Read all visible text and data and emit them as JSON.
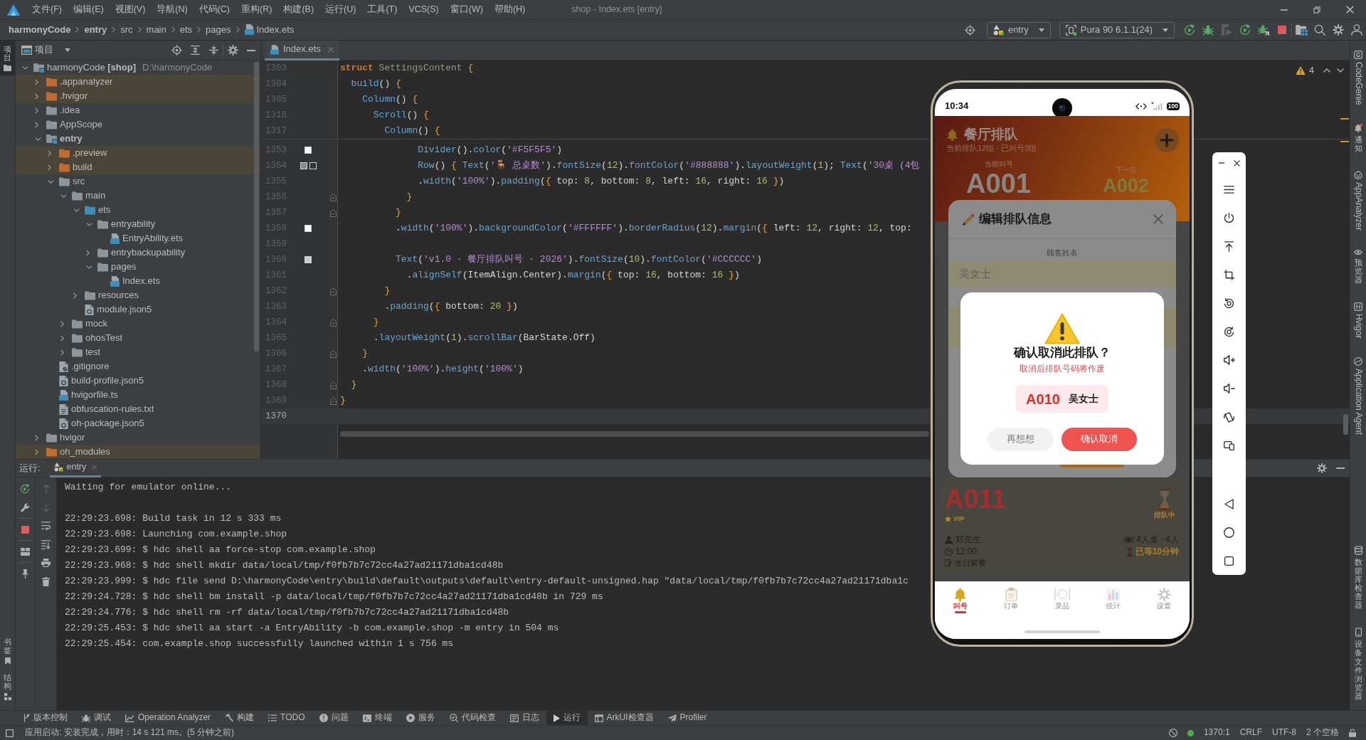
{
  "window": {
    "title": "shop - Index.ets [entry]"
  },
  "menu": [
    "文件(F)",
    "编辑(E)",
    "视图(V)",
    "导航(N)",
    "代码(C)",
    "重构(R)",
    "构建(B)",
    "运行(U)",
    "工具(T)",
    "VCS(S)",
    "窗口(W)",
    "帮助(H)"
  ],
  "breadcrumb": [
    {
      "label": "harmonyCode",
      "kind": "module"
    },
    {
      "label": "entry",
      "kind": "module"
    },
    {
      "label": "src",
      "kind": "folder"
    },
    {
      "label": "main",
      "kind": "folder"
    },
    {
      "label": "ets",
      "kind": "folder"
    },
    {
      "label": "pages",
      "kind": "folder"
    },
    {
      "label": "Index.ets",
      "kind": "file"
    }
  ],
  "run_toolbar": {
    "module": "entry",
    "device": "Pura 90 6.1.1(24)"
  },
  "left_strip": {
    "top": [
      {
        "label": "项目",
        "selected": true
      }
    ],
    "bottom": [
      {
        "label": "书签",
        "selected": false
      },
      {
        "label": "结构",
        "selected": false
      }
    ]
  },
  "project_panel": {
    "title": "项目",
    "tree": [
      {
        "label": "harmonyCode **[shop]**",
        "location": "D:\\harmonyCode",
        "kind": "project",
        "expanded": true,
        "children": [
          {
            "label": ".appanalyzer",
            "kind": "excluded",
            "expanded": false
          },
          {
            "label": ".hvigor",
            "kind": "excluded",
            "expanded": false
          },
          {
            "label": ".idea",
            "kind": "folder",
            "expanded": false
          },
          {
            "label": "AppScope",
            "kind": "folder",
            "expanded": false
          },
          {
            "label": "entry",
            "kind": "module",
            "expanded": true,
            "children": [
              {
                "label": ".preview",
                "kind": "excluded",
                "expanded": false
              },
              {
                "label": "build",
                "kind": "excluded",
                "expanded": false
              },
              {
                "label": "src",
                "kind": "folder",
                "expanded": true,
                "children": [
                  {
                    "label": "main",
                    "kind": "folder",
                    "expanded": true,
                    "children": [
                      {
                        "label": "ets",
                        "kind": "source",
                        "expanded": true,
                        "children": [
                          {
                            "label": "entryability",
                            "kind": "folder",
                            "expanded": true,
                            "children": [
                              {
                                "label": "EntryAbility.ets",
                                "kind": "ets"
                              }
                            ]
                          },
                          {
                            "label": "entrybackupability",
                            "kind": "folder",
                            "expanded": false
                          },
                          {
                            "label": "pages",
                            "kind": "folder",
                            "expanded": true,
                            "children": [
                              {
                                "label": "Index.ets",
                                "kind": "ets"
                              }
                            ]
                          }
                        ]
                      },
                      {
                        "label": "resources",
                        "kind": "folder",
                        "expanded": false
                      },
                      {
                        "label": "module.json5",
                        "kind": "config"
                      }
                    ]
                  },
                  {
                    "label": "mock",
                    "kind": "folder",
                    "expanded": false
                  },
                  {
                    "label": "ohosTest",
                    "kind": "folder",
                    "expanded": false
                  },
                  {
                    "label": "test",
                    "kind": "folder",
                    "expanded": false
                  }
                ]
              },
              {
                "label": ".gitignore",
                "kind": "ignore"
              },
              {
                "label": "build-profile.json5",
                "kind": "config"
              },
              {
                "label": "hvigorfile.ts",
                "kind": "ts"
              },
              {
                "label": "obfuscation-rules.txt",
                "kind": "text"
              },
              {
                "label": "oh-package.json5",
                "kind": "config"
              }
            ]
          },
          {
            "label": "hvigor",
            "kind": "folder",
            "expanded": false
          },
          {
            "label": "oh_modules",
            "kind": "excluded",
            "expanded": false
          }
        ]
      }
    ]
  },
  "editor": {
    "tabs": [
      {
        "label": "Index.ets",
        "selected": true
      }
    ],
    "warnings": "4",
    "sticky_lines": [
      {
        "number": "1303",
        "tokens": [
          {
            "text": "struct",
            "kind": "keyword"
          },
          {
            "text": " SettingsContent ",
            "kind": "type"
          },
          {
            "text": "{",
            "kind": "bracket"
          }
        ]
      },
      {
        "number": "1304",
        "tokens": [
          {
            "text": "  build",
            "kind": "call"
          },
          {
            "text": "() ",
            "kind": "plain"
          },
          {
            "text": "{",
            "kind": "bracket"
          }
        ]
      },
      {
        "number": "1305",
        "tokens": [
          {
            "text": "    Column",
            "kind": "call"
          },
          {
            "text": "() ",
            "kind": "plain"
          },
          {
            "text": "{",
            "kind": "bracket"
          }
        ]
      },
      {
        "number": "1316",
        "tokens": [
          {
            "text": "      Scroll",
            "kind": "call"
          },
          {
            "text": "() ",
            "kind": "plain"
          },
          {
            "text": "{",
            "kind": "bracket"
          }
        ]
      },
      {
        "number": "1317",
        "tokens": [
          {
            "text": "        Column",
            "kind": "call"
          },
          {
            "text": "() ",
            "kind": "plain"
          },
          {
            "text": "{",
            "kind": "bracket"
          }
        ]
      }
    ],
    "lines": [
      {
        "number": "1353",
        "selected": false,
        "fold": false,
        "swatches": [
          {
            "color": "#f5f5f5"
          }
        ],
        "tokens": [
          {
            "text": "              Divider",
            "kind": "call"
          },
          {
            "text": "().",
            "kind": "plain"
          },
          {
            "text": "color",
            "kind": "call"
          },
          {
            "text": "(",
            "kind": "plain"
          },
          {
            "text": "'#F5F5F5'",
            "kind": "string"
          },
          {
            "text": ")",
            "kind": "plain"
          }
        ]
      },
      {
        "number": "1354",
        "selected": false,
        "fold": false,
        "swatches": [
          {
            "color": "#888888"
          },
          {
            "color": "#333333"
          }
        ],
        "tokens": [
          {
            "text": "              Row",
            "kind": "call"
          },
          {
            "text": "() ",
            "kind": "plain"
          },
          {
            "text": "{",
            "kind": "bracket"
          },
          {
            "text": " Text",
            "kind": "call"
          },
          {
            "text": "(",
            "kind": "plain"
          },
          {
            "text": "'🪑 总桌数'",
            "kind": "string"
          },
          {
            "text": ").",
            "kind": "plain"
          },
          {
            "text": "fontSize",
            "kind": "call"
          },
          {
            "text": "(",
            "kind": "plain"
          },
          {
            "text": "12",
            "kind": "number"
          },
          {
            "text": ").",
            "kind": "plain"
          },
          {
            "text": "fontColor",
            "kind": "call"
          },
          {
            "text": "(",
            "kind": "plain"
          },
          {
            "text": "'#888888'",
            "kind": "string"
          },
          {
            "text": ").",
            "kind": "plain"
          },
          {
            "text": "layoutWeight",
            "kind": "call"
          },
          {
            "text": "(",
            "kind": "plain"
          },
          {
            "text": "1",
            "kind": "number"
          },
          {
            "text": "); ",
            "kind": "plain"
          },
          {
            "text": "Text",
            "kind": "call"
          },
          {
            "text": "(",
            "kind": "plain"
          },
          {
            "text": "'30桌 (4包",
            "kind": "string"
          }
        ]
      },
      {
        "number": "1355",
        "selected": false,
        "fold": false,
        "tokens": [
          {
            "text": "              .",
            "kind": "plain"
          },
          {
            "text": "width",
            "kind": "call"
          },
          {
            "text": "(",
            "kind": "plain"
          },
          {
            "text": "'100%'",
            "kind": "string"
          },
          {
            "text": ").",
            "kind": "plain"
          },
          {
            "text": "padding",
            "kind": "call"
          },
          {
            "text": "(",
            "kind": "plain"
          },
          {
            "text": "{",
            "kind": "bracket"
          },
          {
            "text": " top: ",
            "kind": "plain"
          },
          {
            "text": "8",
            "kind": "number"
          },
          {
            "text": ", bottom: ",
            "kind": "plain"
          },
          {
            "text": "8",
            "kind": "number"
          },
          {
            "text": ", left: ",
            "kind": "plain"
          },
          {
            "text": "16",
            "kind": "number"
          },
          {
            "text": ", right: ",
            "kind": "plain"
          },
          {
            "text": "16",
            "kind": "number"
          },
          {
            "text": " }",
            "kind": "bracket"
          },
          {
            "text": ")",
            "kind": "plain"
          }
        ]
      },
      {
        "number": "1356",
        "selected": false,
        "fold": true,
        "tokens": [
          {
            "text": "            }",
            "kind": "bracket"
          }
        ]
      },
      {
        "number": "1357",
        "selected": false,
        "fold": true,
        "tokens": [
          {
            "text": "          }",
            "kind": "bracket"
          }
        ]
      },
      {
        "number": "1358",
        "selected": false,
        "fold": false,
        "swatches": [
          {
            "color": "#ffffff"
          }
        ],
        "tokens": [
          {
            "text": "          .",
            "kind": "plain"
          },
          {
            "text": "width",
            "kind": "call"
          },
          {
            "text": "(",
            "kind": "plain"
          },
          {
            "text": "'100%'",
            "kind": "string"
          },
          {
            "text": ").",
            "kind": "plain"
          },
          {
            "text": "backgroundColor",
            "kind": "call"
          },
          {
            "text": "(",
            "kind": "plain"
          },
          {
            "text": "'#FFFFFF'",
            "kind": "string"
          },
          {
            "text": ").",
            "kind": "plain"
          },
          {
            "text": "borderRadius",
            "kind": "call"
          },
          {
            "text": "(",
            "kind": "plain"
          },
          {
            "text": "12",
            "kind": "number"
          },
          {
            "text": ").",
            "kind": "plain"
          },
          {
            "text": "margin",
            "kind": "call"
          },
          {
            "text": "(",
            "kind": "plain"
          },
          {
            "text": "{",
            "kind": "bracket"
          },
          {
            "text": " left: ",
            "kind": "plain"
          },
          {
            "text": "12",
            "kind": "number"
          },
          {
            "text": ", right: ",
            "kind": "plain"
          },
          {
            "text": "12",
            "kind": "number"
          },
          {
            "text": ", top:",
            "kind": "plain"
          }
        ]
      },
      {
        "number": "1359",
        "selected": false,
        "fold": false
      },
      {
        "number": "1360",
        "selected": false,
        "fold": false,
        "swatches": [
          {
            "color": "#cccccc"
          }
        ],
        "tokens": [
          {
            "text": "          Text",
            "kind": "call"
          },
          {
            "text": "(",
            "kind": "plain"
          },
          {
            "text": "'v1.0 · 餐厅排队叫号 · 2026'",
            "kind": "string"
          },
          {
            "text": ").",
            "kind": "plain"
          },
          {
            "text": "fontSize",
            "kind": "call"
          },
          {
            "text": "(",
            "kind": "plain"
          },
          {
            "text": "10",
            "kind": "number"
          },
          {
            "text": ").",
            "kind": "plain"
          },
          {
            "text": "fontColor",
            "kind": "call"
          },
          {
            "text": "(",
            "kind": "plain"
          },
          {
            "text": "'#CCCCCC'",
            "kind": "string"
          },
          {
            "text": ")",
            "kind": "plain"
          }
        ]
      },
      {
        "number": "1361",
        "selected": false,
        "fold": false,
        "tokens": [
          {
            "text": "            .",
            "kind": "plain"
          },
          {
            "text": "alignSelf",
            "kind": "call"
          },
          {
            "text": "(ItemAlign.Center).",
            "kind": "plain"
          },
          {
            "text": "margin",
            "kind": "call"
          },
          {
            "text": "(",
            "kind": "plain"
          },
          {
            "text": "{",
            "kind": "bracket"
          },
          {
            "text": " top: ",
            "kind": "plain"
          },
          {
            "text": "16",
            "kind": "number"
          },
          {
            "text": ", bottom: ",
            "kind": "plain"
          },
          {
            "text": "16",
            "kind": "number"
          },
          {
            "text": " }",
            "kind": "bracket"
          },
          {
            "text": ")",
            "kind": "plain"
          }
        ]
      },
      {
        "number": "1362",
        "selected": false,
        "fold": true,
        "tokens": [
          {
            "text": "        }",
            "kind": "bracket"
          }
        ]
      },
      {
        "number": "1363",
        "selected": false,
        "fold": false,
        "tokens": [
          {
            "text": "        .",
            "kind": "plain"
          },
          {
            "text": "padding",
            "kind": "call"
          },
          {
            "text": "(",
            "kind": "plain"
          },
          {
            "text": "{",
            "kind": "bracket"
          },
          {
            "text": " bottom: ",
            "kind": "plain"
          },
          {
            "text": "20",
            "kind": "number"
          },
          {
            "text": " }",
            "kind": "bracket"
          },
          {
            "text": ")",
            "kind": "plain"
          }
        ]
      },
      {
        "number": "1364",
        "selected": false,
        "fold": true,
        "tokens": [
          {
            "text": "      }",
            "kind": "bracket"
          }
        ]
      },
      {
        "number": "1365",
        "selected": false,
        "fold": false,
        "tokens": [
          {
            "text": "      .",
            "kind": "plain"
          },
          {
            "text": "layoutWeight",
            "kind": "call"
          },
          {
            "text": "(",
            "kind": "plain"
          },
          {
            "text": "1",
            "kind": "number"
          },
          {
            "text": ").",
            "kind": "plain"
          },
          {
            "text": "scrollBar",
            "kind": "call"
          },
          {
            "text": "(BarState.Off)",
            "kind": "plain"
          }
        ]
      },
      {
        "number": "1366",
        "selected": false,
        "fold": true,
        "tokens": [
          {
            "text": "    }",
            "kind": "bracket"
          }
        ]
      },
      {
        "number": "1367",
        "selected": false,
        "fold": false,
        "tokens": [
          {
            "text": "    .",
            "kind": "plain"
          },
          {
            "text": "width",
            "kind": "call"
          },
          {
            "text": "(",
            "kind": "plain"
          },
          {
            "text": "'100%'",
            "kind": "string"
          },
          {
            "text": ").",
            "kind": "plain"
          },
          {
            "text": "height",
            "kind": "call"
          },
          {
            "text": "(",
            "kind": "plain"
          },
          {
            "text": "'100%'",
            "kind": "string"
          },
          {
            "text": ")",
            "kind": "plain"
          }
        ]
      },
      {
        "number": "1368",
        "selected": false,
        "fold": true,
        "tokens": [
          {
            "text": "  }",
            "kind": "bracket"
          }
        ]
      },
      {
        "number": "1369",
        "selected": false,
        "fold": true,
        "tokens": [
          {
            "text": "}",
            "kind": "bracket"
          }
        ]
      },
      {
        "number": "1370",
        "selected": true,
        "fold": false
      }
    ]
  },
  "right_strip": {
    "top": [
      {
        "label": "CodeGenie",
        "unread": false
      },
      {
        "label": "通知",
        "unread": true
      },
      {
        "label": "AppAnalyzer",
        "unread": false
      },
      {
        "label": "预览器",
        "unread": false
      },
      {
        "label": "Hvigor",
        "unread": false
      },
      {
        "label": "Application Agent",
        "unread": false
      }
    ],
    "bottom": [
      {
        "label": "数据库检查器"
      },
      {
        "label": "设备文件浏览器"
      }
    ]
  },
  "run_panel": {
    "title": "运行:",
    "tabs": [
      {
        "label": "entry",
        "selected": true
      }
    ],
    "console_blocks": [
      [
        "Waiting for emulator online..."
      ],
      [
        "22:29:23.698: Build task in 12 s 333 ms",
        "22:29:23.698: Launching com.example.shop",
        "22:29:23.699: $ hdc shell aa force-stop com.example.shop",
        "22:29:23.968: $ hdc shell mkdir data/local/tmp/f0fb7b7c72cc4a27ad21171dba1cd48b",
        "22:29:23.999: $ hdc file send D:\\harmonyCode\\entry\\build\\default\\outputs\\default\\entry-default-unsigned.hap \"data/local/tmp/f0fb7b7c72cc4a27ad21171dba1c",
        "22:29:24.728: $ hdc shell bm install -p data/local/tmp/f0fb7b7c72cc4a27ad21171dba1cd48b in 729 ms",
        "22:29:24.776: $ hdc shell rm -rf data/local/tmp/f0fb7b7c72cc4a27ad21171dba1cd48b",
        "22:29:25.453: $ hdc shell aa start -a EntryAbility -b com.example.shop -m entry in 504 ms",
        "22:29:25.454: com.example.shop successfully launched within 1 s 756 ms"
      ]
    ]
  },
  "tool_windows": [
    {
      "label": "版本控制",
      "selected": false
    },
    {
      "label": "调试",
      "selected": false
    },
    {
      "label": "Operation Analyzer",
      "selected": false
    },
    {
      "label": "构建",
      "selected": false
    },
    {
      "label": "TODO",
      "selected": false
    },
    {
      "label": "问题",
      "selected": false
    },
    {
      "label": "终端",
      "selected": false
    },
    {
      "label": "服务",
      "selected": false
    },
    {
      "label": "代码检查",
      "selected": false
    },
    {
      "label": "日志",
      "selected": false
    },
    {
      "label": "运行",
      "selected": true
    },
    {
      "label": "ArkUI检查器",
      "selected": false
    },
    {
      "label": "Profiler",
      "selected": false
    }
  ],
  "status_bar": {
    "message": "应用启动: 安装完成，用时：14 s 121 ms。(5 分钟之前)",
    "position": "1370:1",
    "line_separator": "CRLF",
    "encoding": "UTF-8",
    "indent": "2 个空格"
  },
  "emulator": {
    "status_bar": {
      "time": "10:34",
      "battery": "100"
    },
    "header": {
      "title": "餐厅排队",
      "summary": "当前排队12组 · 已叫号3组",
      "current_label": "当前叫号",
      "current_number": "A001",
      "next_label": "下一位",
      "next_number": "A002"
    },
    "card": {
      "number": "A011",
      "tag": "VIP",
      "status": "排队中",
      "customer": "郑先生",
      "time": "12:00",
      "note": "生日聚餐",
      "table": "4人桌 · 4人",
      "wait": "已等10分钟"
    },
    "edit_dialog": {
      "title": "编辑排队信息",
      "name_label": "顾客姓名",
      "name_value": "吴女士"
    },
    "confirm_dialog": {
      "title": "确认取消此排队？",
      "message": "取消后排队号码将作废",
      "number": "A010",
      "customer": "吴女士",
      "buttons": [
        {
          "label": "再想想",
          "kind": "secondary"
        },
        {
          "label": "确认取消",
          "kind": "danger"
        }
      ]
    },
    "nav": [
      {
        "label": "叫号",
        "selected": true
      },
      {
        "label": "订单",
        "selected": false
      },
      {
        "label": "菜品",
        "selected": false
      },
      {
        "label": "统计",
        "selected": false
      },
      {
        "label": "设置",
        "selected": false
      }
    ]
  }
}
